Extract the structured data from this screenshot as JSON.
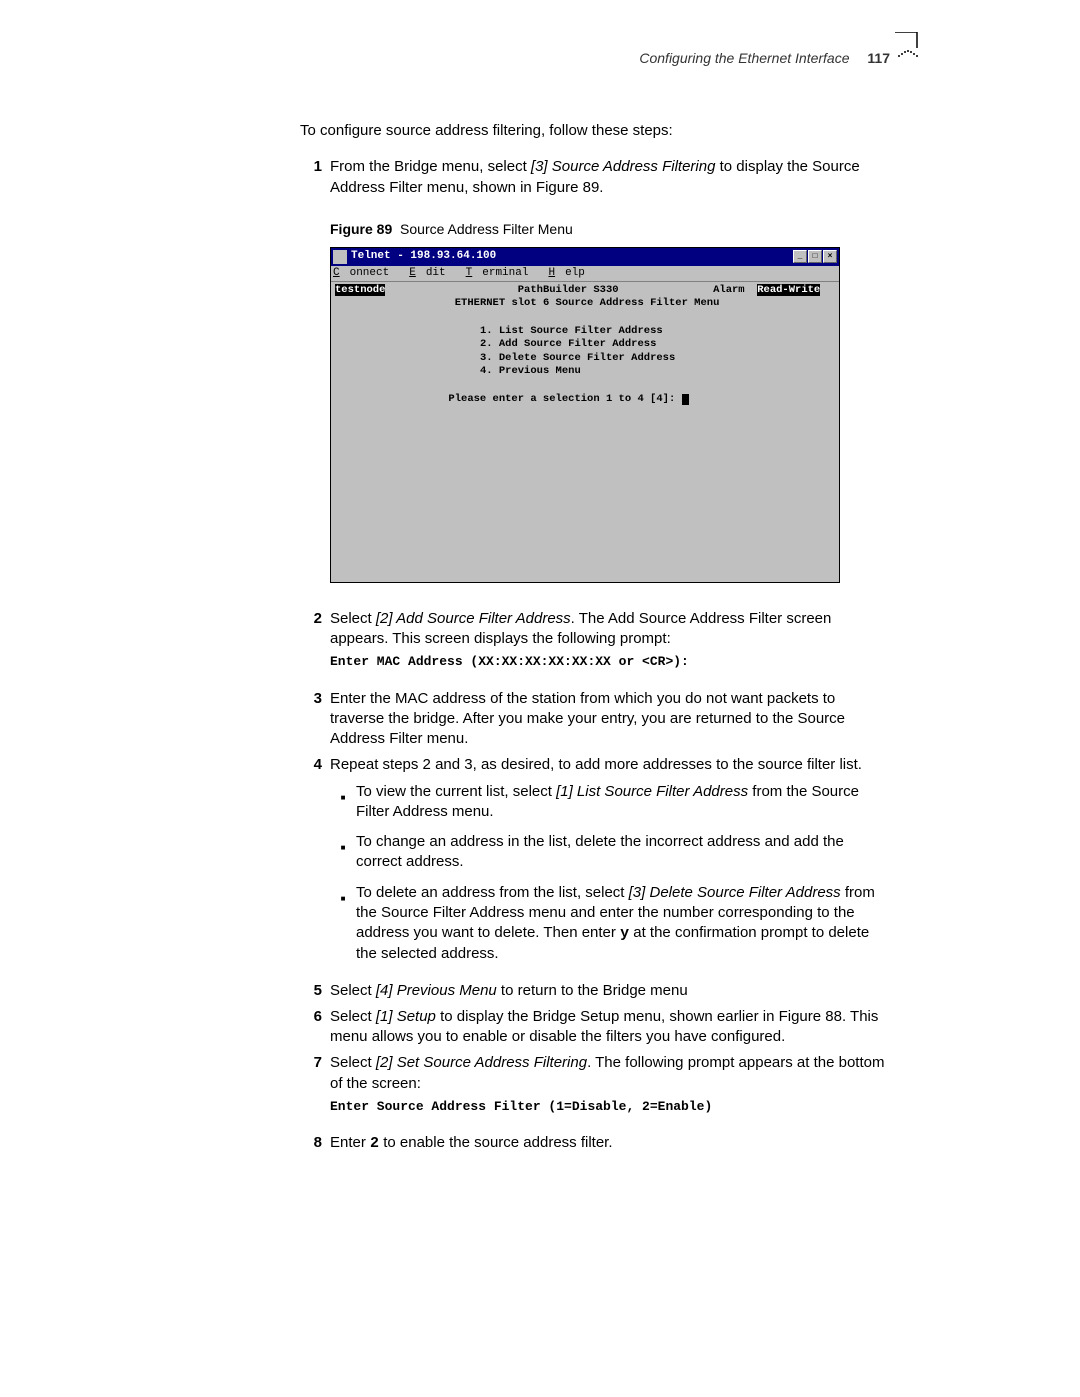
{
  "header": {
    "section": "Configuring the Ethernet Interface",
    "page": "117"
  },
  "intro": "To configure source address filtering, follow these steps:",
  "steps": {
    "s1": {
      "num": "1",
      "prefix": "From the Bridge menu, select ",
      "italic1": "[3] Source Address Filtering",
      "suffix": " to display the Source Address Filter menu, shown in Figure 89."
    },
    "s2": {
      "num": "2",
      "prefix": "Select ",
      "italic1": "[2] Add Source Filter Address",
      "suffix": ". The Add Source Address Filter screen appears. This screen displays the following prompt:"
    },
    "s3": {
      "num": "3",
      "text": "Enter the MAC address of the station from which you do not want packets to traverse the bridge. After you make your entry, you are returned to the Source Address Filter menu."
    },
    "s4": {
      "num": "4",
      "text": "Repeat steps 2 and 3, as desired, to add more addresses to the source filter list.",
      "b1_pre": "To view the current list, select ",
      "b1_it": "[1] List Source Filter Address",
      "b1_post": " from the Source Filter Address menu.",
      "b2": "To change an address in the list, delete the incorrect address and add the correct address.",
      "b3_pre": "To delete an address from the list, select ",
      "b3_it": "[3] Delete Source Filter Address",
      "b3_mid": " from the Source Filter Address menu and enter the number corresponding to the address you want to delete. Then enter ",
      "b3_key": "y",
      "b3_post": " at the confirmation prompt to delete the selected address."
    },
    "s5": {
      "num": "5",
      "prefix": "Select ",
      "italic1": "[4] Previous Menu",
      "suffix": " to return to the Bridge menu"
    },
    "s6": {
      "num": "6",
      "prefix": "Select ",
      "italic1": "[1] Setup",
      "suffix": " to display the Bridge Setup menu, shown earlier in Figure 88. This menu allows you to enable or disable the filters you have configured."
    },
    "s7": {
      "num": "7",
      "prefix": "Select ",
      "italic1": "[2] Set Source Address Filtering",
      "suffix": ". The following prompt appears at the bottom of the screen:"
    },
    "s8": {
      "num": "8",
      "prefix": "Enter ",
      "key": "2",
      "suffix": " to enable the source address filter."
    }
  },
  "figure": {
    "label": "Figure 89",
    "caption": "Source Address Filter Menu"
  },
  "telnet": {
    "title": "Telnet - 198.93.64.100",
    "menu": {
      "m1_u": "C",
      "m1_r": "onnect",
      "m2_u": "E",
      "m2_r": "dit",
      "m3_u": "T",
      "m3_r": "erminal",
      "m4_u": "H",
      "m4_r": "elp"
    },
    "hostname": "testnode",
    "product": "PathBuilder S330",
    "alarm": "Alarm",
    "mode": "Read-Write",
    "subtitle": "ETHERNET slot 6 Source Address Filter Menu",
    "opt1": "1. List Source Filter Address",
    "opt2": "2. Add Source Filter Address",
    "opt3": "3. Delete Source Filter Address",
    "opt4": "4. Previous Menu",
    "prompt": "Please enter a selection 1 to 4 [4]: "
  },
  "code": {
    "c1": "Enter MAC Address (XX:XX:XX:XX:XX:XX or <CR>):",
    "c2": "Enter Source Address Filter (1=Disable, 2=Enable)"
  }
}
